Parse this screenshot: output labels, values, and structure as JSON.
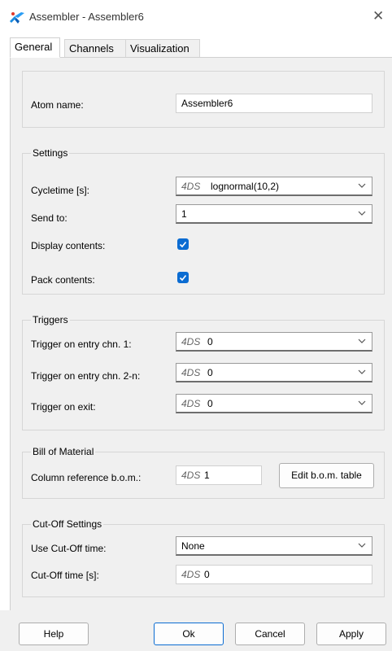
{
  "window": {
    "title": "Assembler - Assembler6",
    "close_glyph": "✕",
    "icon": "enterprise-dynamics-icon"
  },
  "tabs": [
    {
      "label": "General",
      "active": true
    },
    {
      "label": "Channels",
      "active": false
    },
    {
      "label": "Visualization",
      "active": false
    }
  ],
  "atom": {
    "label": "Atom name:",
    "value": "Assembler6"
  },
  "settings": {
    "title": "Settings",
    "cycletime_label": "Cycletime [s]:",
    "cycletime_tag": "4DS",
    "cycletime_value": "lognormal(10,2)",
    "sendto_label": "Send to:",
    "sendto_value": "1",
    "display_label": "Display contents:",
    "display_checked": true,
    "pack_label": "Pack contents:",
    "pack_checked": true
  },
  "triggers": {
    "title": "Triggers",
    "entry1_label": "Trigger on entry chn. 1:",
    "entry1_tag": "4DS",
    "entry1_value": "0",
    "entry2n_label": "Trigger on entry chn. 2-n:",
    "entry2n_tag": "4DS",
    "entry2n_value": "0",
    "exit_label": "Trigger on exit:",
    "exit_tag": "4DS",
    "exit_value": "0"
  },
  "bom": {
    "title": "Bill of Material",
    "column_label": "Column reference b.o.m.:",
    "column_tag": "4DS",
    "column_value": "1",
    "edit_button": "Edit b.o.m. table"
  },
  "cutoff": {
    "title": "Cut-Off Settings",
    "use_label": "Use Cut-Off time:",
    "use_value": "None",
    "time_label": "Cut-Off time [s]:",
    "time_tag": "4DS",
    "time_value": "0"
  },
  "buttons": {
    "help": "Help",
    "ok": "Ok",
    "cancel": "Cancel",
    "apply": "Apply"
  },
  "colors": {
    "accent": "#0b6cd2",
    "panel_bg": "#f0f0f0"
  }
}
